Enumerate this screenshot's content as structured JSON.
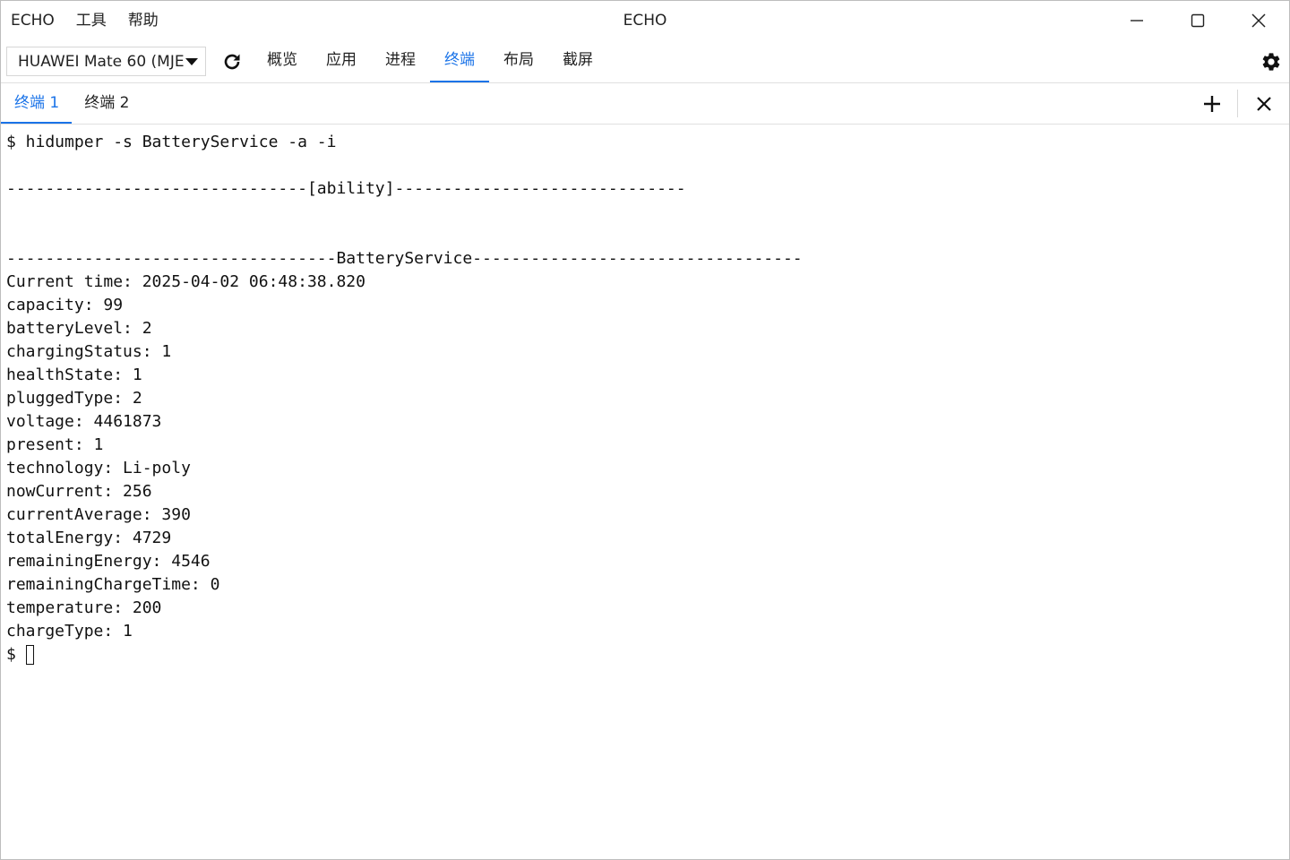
{
  "titlebar": {
    "title": "ECHO",
    "menu": [
      "ECHO",
      "工具",
      "帮助"
    ]
  },
  "toolbar": {
    "device_select_value": "HUAWEI Mate 60 (MJE",
    "tabs": [
      "概览",
      "应用",
      "进程",
      "终端",
      "布局",
      "截屏"
    ],
    "active_tab": "终端"
  },
  "terminal_tabs": {
    "tabs": [
      "终端 1",
      "终端 2"
    ],
    "active_tab": "终端 1"
  },
  "terminal": {
    "lines": [
      "$ hidumper -s BatteryService -a -i",
      "",
      "-------------------------------[ability]------------------------------",
      "",
      "",
      "----------------------------------BatteryService----------------------------------",
      "Current time: 2025-04-02 06:48:38.820",
      "capacity: 99",
      "batteryLevel: 2",
      "chargingStatus: 1",
      "healthState: 1",
      "pluggedType: 2",
      "voltage: 4461873",
      "present: 1",
      "technology: Li-poly",
      "nowCurrent: 256",
      "currentAverage: 390",
      "totalEnergy: 4729",
      "remainingEnergy: 4546",
      "remainingChargeTime: 0",
      "temperature: 200",
      "chargeType: 1"
    ],
    "prompt": "$"
  },
  "colors": {
    "accent": "#1a73e8",
    "text": "#222222",
    "border": "#e0e0e0"
  },
  "icons": {
    "minimize": "minimize-icon",
    "maximize": "maximize-icon",
    "close": "close-icon",
    "dropdown": "caret-down-icon",
    "refresh": "refresh-icon",
    "settings": "gear-icon",
    "add": "plus-icon",
    "close_tab": "close-icon"
  }
}
